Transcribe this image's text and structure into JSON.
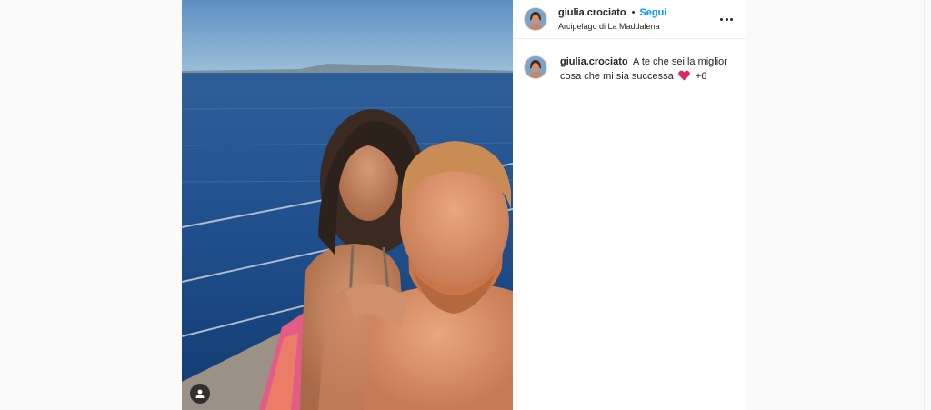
{
  "post": {
    "username": "giulia.crociato",
    "separator": "•",
    "follow_label": "Segui",
    "location": "Arcipelago di La Maddalena",
    "more_icon": "more-options-icon",
    "tag_icon": "user-tag-icon"
  },
  "caption": {
    "username": "giulia.crociato",
    "text": "A te che sei la miglior cosa che mi sia successa",
    "emoji": "red-heart-icon",
    "suffix": "+6"
  },
  "colors": {
    "accent": "#0095f6",
    "text": "#262626",
    "heart": "#e0245e"
  }
}
